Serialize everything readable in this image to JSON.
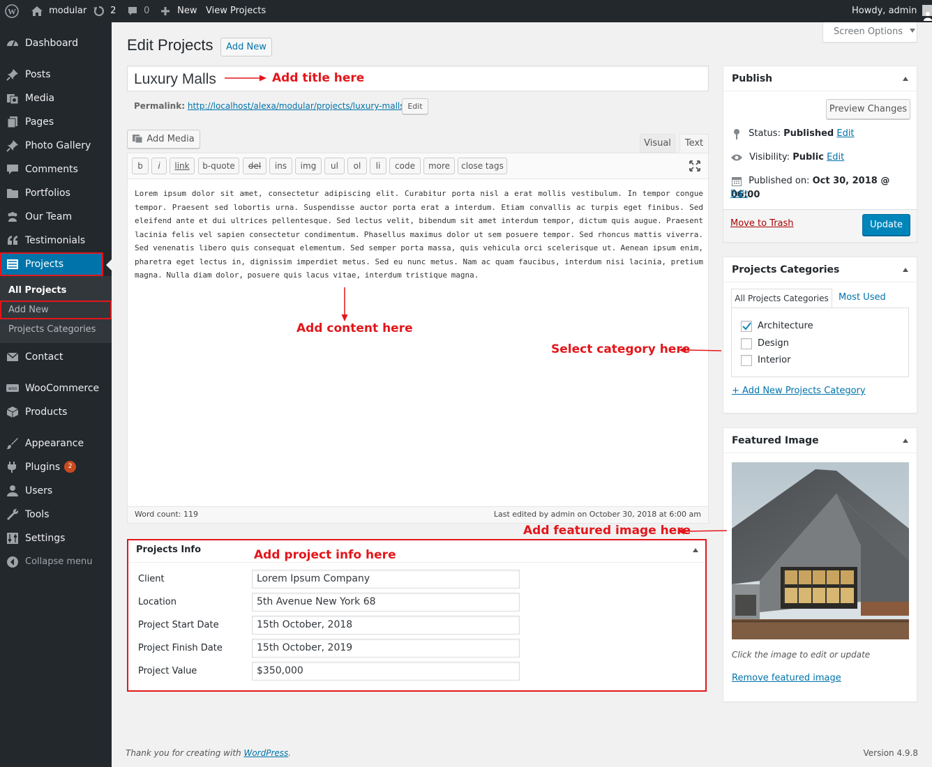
{
  "adminbar": {
    "site_name": "modular",
    "updates_count": "2",
    "comments_count": "0",
    "new_label": "New",
    "view_label": "View Projects",
    "howdy": "Howdy, admin"
  },
  "sidebar": {
    "dashboard": "Dashboard",
    "posts": "Posts",
    "media": "Media",
    "pages": "Pages",
    "photo_gallery": "Photo Gallery",
    "comments": "Comments",
    "portfolios": "Portfolios",
    "our_team": "Our Team",
    "testimonials": "Testimonials",
    "projects": "Projects",
    "all_projects": "All Projects",
    "add_new": "Add New",
    "projects_categories": "Projects Categories",
    "contact": "Contact",
    "woocommerce": "WooCommerce",
    "products": "Products",
    "appearance": "Appearance",
    "plugins": "Plugins",
    "plugins_badge": "2",
    "users": "Users",
    "tools": "Tools",
    "settings": "Settings",
    "collapse": "Collapse menu"
  },
  "screen_options": "Screen Options",
  "page": {
    "heading": "Edit Projects",
    "add_new": "Add New",
    "post_title": "Luxury Malls",
    "permalink_label": "Permalink:",
    "permalink_base": "http://localhost/alexa/modular/projects/",
    "permalink_slug": "luxury-malls",
    "permalink_end": "/",
    "permalink_edit": "Edit"
  },
  "editor": {
    "add_media": "Add Media",
    "tab_visual": "Visual",
    "tab_text": "Text",
    "quicktags": [
      "b",
      "i",
      "link",
      "b-quote",
      "del",
      "ins",
      "img",
      "ul",
      "ol",
      "li",
      "code",
      "more",
      "close tags"
    ],
    "content": "Lorem ipsum dolor sit amet, consectetur adipiscing elit. Curabitur porta nisl a erat mollis vestibulum. In tempor congue tempor. Praesent sed lobortis urna. Suspendisse auctor porta erat a interdum. Etiam convallis ac turpis eget finibus. Sed eleifend ante et dui ultrices pellentesque. Sed lectus velit, bibendum sit amet interdum tempor, dictum quis augue. Praesent lacinia felis vel sapien consectetur condimentum. Phasellus maximus dolor ut sem posuere tempor. Sed rhoncus mattis viverra. Sed venenatis libero quis consequat elementum. Sed semper porta massa, quis vehicula orci scelerisque ut. Aenean ipsum enim, pharetra eget lectus in, dignissim imperdiet metus. Sed eu nunc metus. Nam ac quam faucibus, interdum nisi lacinia, pretium magna. Nulla diam dolor, posuere quis lacus vitae, interdum tristique magna.",
    "word_count": "Word count: 119",
    "last_edited": "Last edited by admin on October 30, 2018 at 6:00 am"
  },
  "projects_info": {
    "title": "Projects Info",
    "fields": [
      {
        "label": "Client",
        "value": "Lorem Ipsum Company"
      },
      {
        "label": "Location",
        "value": "5th Avenue New York 68"
      },
      {
        "label": "Project Start Date",
        "value": "15th October, 2018"
      },
      {
        "label": "Project Finish Date",
        "value": "15th October, 2019"
      },
      {
        "label": "Project Value",
        "value": "$350,000"
      }
    ]
  },
  "publish": {
    "title": "Publish",
    "preview": "Preview Changes",
    "status_label": "Status:",
    "status_value": "Published",
    "visibility_label": "Visibility:",
    "visibility_value": "Public",
    "published_label": "Published on:",
    "published_value": "Oct 30, 2018 @ 06:00",
    "edit": "Edit",
    "trash": "Move to Trash",
    "update": "Update"
  },
  "categories": {
    "title": "Projects Categories",
    "tab_all": "All Projects Categories",
    "tab_most": "Most Used",
    "items": [
      {
        "label": "Architecture",
        "checked": true
      },
      {
        "label": "Design",
        "checked": false
      },
      {
        "label": "Interior",
        "checked": false
      }
    ],
    "add_new": "+ Add New Projects Category"
  },
  "featured": {
    "title": "Featured Image",
    "hint": "Click the image to edit or update",
    "remove": "Remove featured image"
  },
  "annotations": {
    "title": "Add title here",
    "content": "Add content here",
    "category": "Select category here",
    "featured": "Add featured image here",
    "info": "Add project info here"
  },
  "footer": {
    "thanks": "Thank you for creating with ",
    "wordpress": "WordPress",
    "period": ".",
    "version": "Version 4.9.8"
  },
  "colors": {
    "accent": "#0073aa",
    "annotation": "#e3161b",
    "sidebar": "#23282d"
  }
}
